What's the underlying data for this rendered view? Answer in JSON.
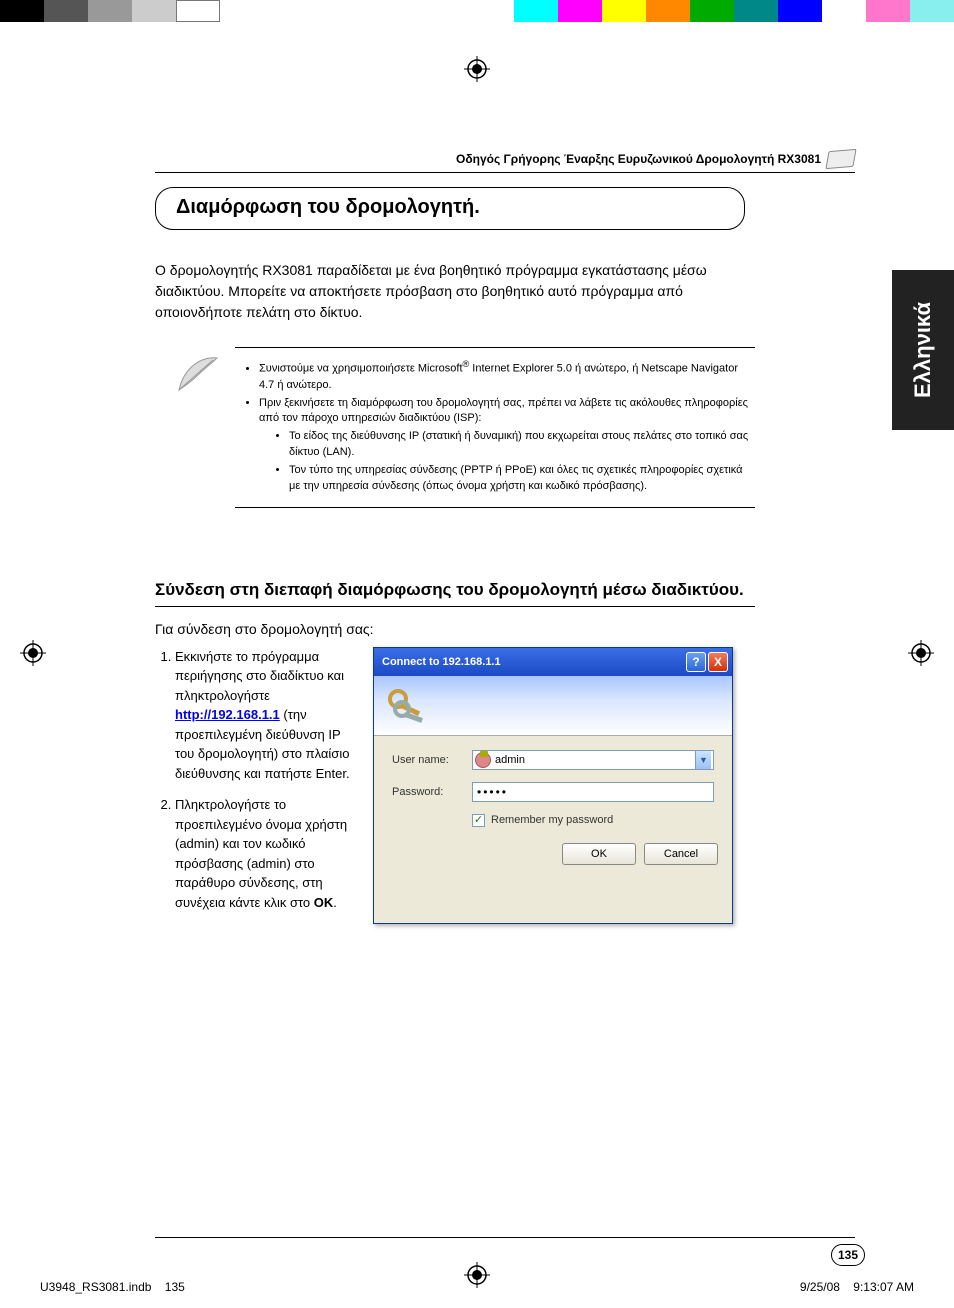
{
  "header_text": "Οδηγός Γρήγορης Έναρξης Ευρυζωνικού Δρομολογητή RX3081",
  "title": "Διαμόρφωση του δρομολογητή.",
  "lang_tab": "Ελληνικά",
  "intro": "Ο δρομολογητής RX3081 παραδίδεται με ένα βοηθητικό πρόγραμμα εγκατάστασης μέσω διαδικτύου. Μπορείτε να αποκτήσετε πρόσβαση στο βοηθητικό αυτό πρόγραμμα από οποιονδήποτε πελάτη στο δίκτυο.",
  "notes": {
    "b1_a": "Συνιστούμε να χρησιμοποιήσετε Microsoft",
    "b1_sup": "®",
    "b1_b": " Internet Explorer 5.0 ή ανώτερο, ή Netscape Navigator 4.7 ή ανώτερο.",
    "b2": "Πριν ξεκινήσετε τη διαμόρφωση του δρομολογητή σας, πρέπει να λάβετε τις ακόλουθες πληροφορίες από τον πάροχο υπηρεσιών διαδικτύου (ISP):",
    "b2a": "Το είδος της διεύθυνσης IP (στατική ή δυναμική) που εκχωρείται στους πελάτες στο τοπικό σας δίκτυο (LAN).",
    "b2b": "Τον τύπο της υπηρεσίας σύνδεσης (PPTP ή PPoE) και όλες τις σχετικές πληροφορίες σχετικά με την υπηρεσία σύνδεσης (όπως όνομα χρήστη και κωδικό πρόσβασης)."
  },
  "subsection": "Σύνδεση στη διεπαφή διαμόρφωσης του δρομολογητή μέσω διαδικτύου.",
  "connect_intro": "Για σύνδεση στο δρομολογητή σας:",
  "steps": {
    "s1_a": "Εκκινήστε το πρόγραμμα περιήγησης στο διαδίκτυο και πληκτρολογήστε ",
    "s1_link": "http://192.168.1.1",
    "s1_b": " (την προεπιλεγμένη διεύθυνση IP του δρομολογητή) στο πλαίσιο διεύθυνσης και πατήστε Enter.",
    "s2_a": "Πληκτρολογήστε το προεπιλεγμένο όνομα χρήστη (admin) και τον κωδικό πρόσβασης (admin) στο παράθυρο σύνδεσης, στη συνέχεια κάντε κλικ στο ",
    "s2_bold": "OK",
    "s2_b": "."
  },
  "dialog": {
    "title": "Connect to 192.168.1.1",
    "user_label": "User name:",
    "user_value": "admin",
    "pwd_label": "Password:",
    "pwd_mask": "•••••",
    "remember": "Remember my password",
    "ok": "OK",
    "cancel": "Cancel",
    "help": "?",
    "close": "X"
  },
  "page_number": "135",
  "footer": {
    "left1": "U3948_RS3081.indb",
    "left2": "135",
    "right1": "9/25/08",
    "right2": "9:13:07 AM"
  }
}
